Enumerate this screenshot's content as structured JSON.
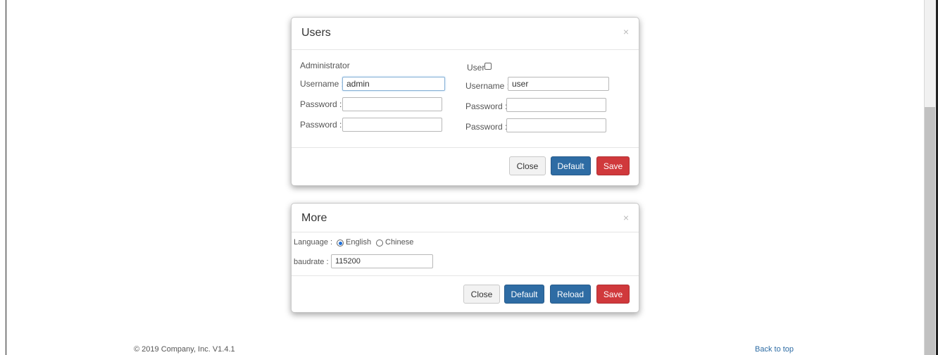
{
  "users_panel": {
    "title": "Users",
    "close_glyph": "×",
    "admin": {
      "heading": "Administrator",
      "username_label": "Username :",
      "username_value": "admin",
      "password_label": "Password :",
      "password2_label": "Password :"
    },
    "user": {
      "heading": "User",
      "username_label": "Username :",
      "username_value": "user",
      "password_label": "Password :",
      "password2_label": "Password :",
      "enabled": false
    },
    "buttons": {
      "close": "Close",
      "default": "Default",
      "save": "Save"
    }
  },
  "more_panel": {
    "title": "More",
    "close_glyph": "×",
    "language_label": "Language :",
    "language_options": [
      "English",
      "Chinese"
    ],
    "language_selected": "English",
    "baudrate_label": "baudrate :",
    "baudrate_value": "115200",
    "buttons": {
      "close": "Close",
      "default": "Default",
      "reload": "Reload",
      "save": "Save"
    }
  },
  "footer": {
    "copyright": "© 2019 Company, Inc. V1.4.1",
    "back_to_top": "Back to top"
  },
  "colors": {
    "primary": "#2e6ca4",
    "danger": "#d0393c",
    "radio_selected": "#1e6fd9"
  }
}
